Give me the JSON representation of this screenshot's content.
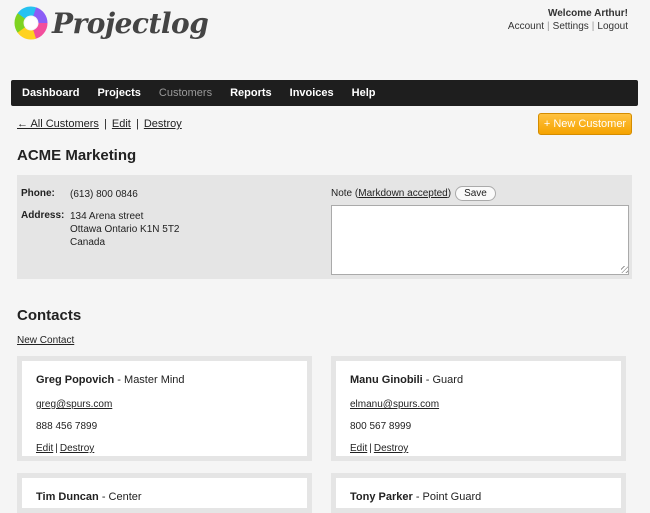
{
  "brand": {
    "name": "Projectlog",
    "logo_colors": [
      "#f24e9c",
      "#ffd21f",
      "#7ed321",
      "#27c2f0",
      "#8b5cf6"
    ]
  },
  "user": {
    "welcome": "Welcome Arthur!",
    "links": [
      "Account",
      "Settings",
      "Logout"
    ]
  },
  "nav": {
    "items": [
      {
        "label": "Dashboard",
        "active": false
      },
      {
        "label": "Projects",
        "active": false
      },
      {
        "label": "Customers",
        "active": true
      },
      {
        "label": "Reports",
        "active": false
      },
      {
        "label": "Invoices",
        "active": false
      },
      {
        "label": "Help",
        "active": false
      }
    ]
  },
  "breadcrumb": {
    "back": "← All Customers",
    "edit": "Edit",
    "destroy": "Destroy"
  },
  "actions": {
    "new_customer": "+ New Customer"
  },
  "customer": {
    "name": "ACME Marketing",
    "phone_label": "Phone:",
    "phone": "(613) 800 0846",
    "address_label": "Address:",
    "address_lines": [
      "134 Arena street",
      "Ottawa Ontario K1N 5T2",
      "Canada"
    ],
    "note_label": "Note (",
    "note_link": "Markdown accepted",
    "note_close": ")",
    "note_save": "Save",
    "note_value": ""
  },
  "contacts": {
    "title": "Contacts",
    "new_contact": "New Contact",
    "items": [
      {
        "name": "Greg Popovich",
        "role": " - Master Mind",
        "email": "greg@spurs.com",
        "phone": "888 456 7899",
        "edit": "Edit",
        "destroy": "Destroy"
      },
      {
        "name": "Manu Ginobili",
        "role": " - Guard",
        "email": "elmanu@spurs.com",
        "phone": "800 567 8999",
        "edit": "Edit",
        "destroy": "Destroy"
      },
      {
        "name": "Tim Duncan",
        "role": " - Center",
        "email": "",
        "phone": "",
        "edit": "",
        "destroy": ""
      },
      {
        "name": "Tony Parker",
        "role": " - Point Guard",
        "email": "",
        "phone": "",
        "edit": "",
        "destroy": ""
      }
    ]
  },
  "colors": {
    "nav_bg": "#1e1e1e",
    "accent": "#f5a300",
    "panel_bg": "#e5e5e5"
  }
}
